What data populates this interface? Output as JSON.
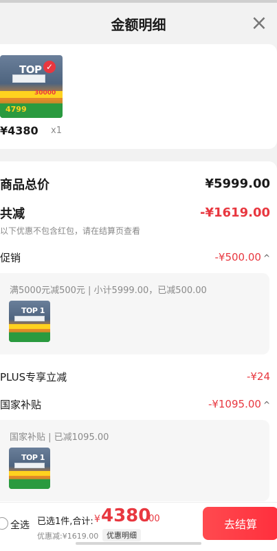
{
  "header": {
    "title": "金额明细",
    "close_icon": "close-icon"
  },
  "product": {
    "price": "¥4380",
    "quantity": "x1",
    "thumb_text": "TOP",
    "thumb_price": "4799",
    "thumb_coupon": "30000"
  },
  "summary": {
    "total_label": "商品总价",
    "total_value": "¥5999.00",
    "reduce_label": "共减",
    "reduce_value": "-¥1619.00",
    "note": "以下优惠不包含红包，请在结算页查看"
  },
  "promo": {
    "label": "促销",
    "value": "-¥500.00",
    "detail": "满5000元减500元 | 小计5999.00，已减500.00",
    "thumb_text": "TOP 1"
  },
  "plus": {
    "label": "PLUS专享立减",
    "value": "-¥24"
  },
  "subsidy": {
    "label": "国家补贴",
    "value": "-¥1095.00",
    "detail": "国家补贴 | 已减1095.00",
    "thumb_text": "TOP 1"
  },
  "bottom": {
    "select_all": "全选",
    "selected": "已选1件,合计:",
    "currency": "¥",
    "total_int": "4380",
    "total_dec": ".00",
    "discount": "优惠减:¥1619.00",
    "detail_button": "优惠明细",
    "checkout": "去结算"
  },
  "colors": {
    "accent_red": "#e8373f",
    "checkout_button": "#ff2f3d",
    "background": "#f2f2f2"
  }
}
